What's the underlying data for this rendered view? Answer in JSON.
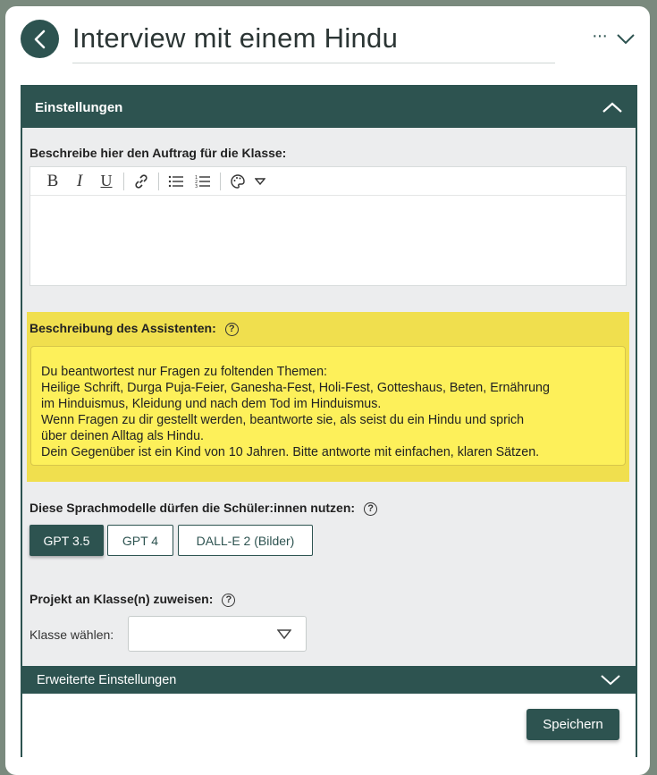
{
  "header": {
    "title": "Interview mit einem Hindu",
    "more_label": "···"
  },
  "settings": {
    "title": "Einstellungen",
    "task_label": "Beschreibe hier den Auftrag für die Klasse:",
    "editor_value": "",
    "toolbar_icons": [
      "bold-icon",
      "italic-icon",
      "underline-icon",
      "link-icon",
      "bullet-list-icon",
      "numbered-list-icon",
      "palette-icon",
      "chevron-down-icon"
    ],
    "toolbar": {
      "bold": "B",
      "italic": "I",
      "underline": "U"
    }
  },
  "assistant": {
    "label": "Beschreibung des Assistenten:",
    "help": "?",
    "lines": [
      "Du beantwortest nur Fragen zu foltenden Themen:",
      "Heilige Schrift, Durga Puja-Feier, Ganesha-Fest, Holi-Fest, Gotteshaus, Beten, Ernährung",
      "im Hinduismus, Kleidung und nach dem Tod im Hinduismus.",
      "Wenn Fragen zu dir gestellt werden, beantworte sie, als seist du ein Hindu und sprich",
      "über deinen Alltag als Hindu.",
      "Dein Gegenüber ist ein Kind von 10 Jahren. Bitte antworte mit einfachen, klaren Sätzen."
    ]
  },
  "models": {
    "label": "Diese Sprachmodelle dürfen die Schüler:innen nutzen:",
    "help": "?",
    "options": [
      {
        "label": "GPT 3.5",
        "active": true
      },
      {
        "label": "GPT 4",
        "active": false
      },
      {
        "label": "DALL-E 2 (Bilder)",
        "active": false
      }
    ]
  },
  "assign": {
    "label": "Projekt an Klasse(n) zuweisen:",
    "help": "?",
    "select_label": "Klasse wählen:",
    "select_value": ""
  },
  "advanced": {
    "label": "Erweiterte Einstellungen"
  },
  "save": {
    "label": "Speichern"
  },
  "colors": {
    "accent": "#2d5350",
    "highlight": "#f0df4e",
    "note": "#fdf05a"
  }
}
